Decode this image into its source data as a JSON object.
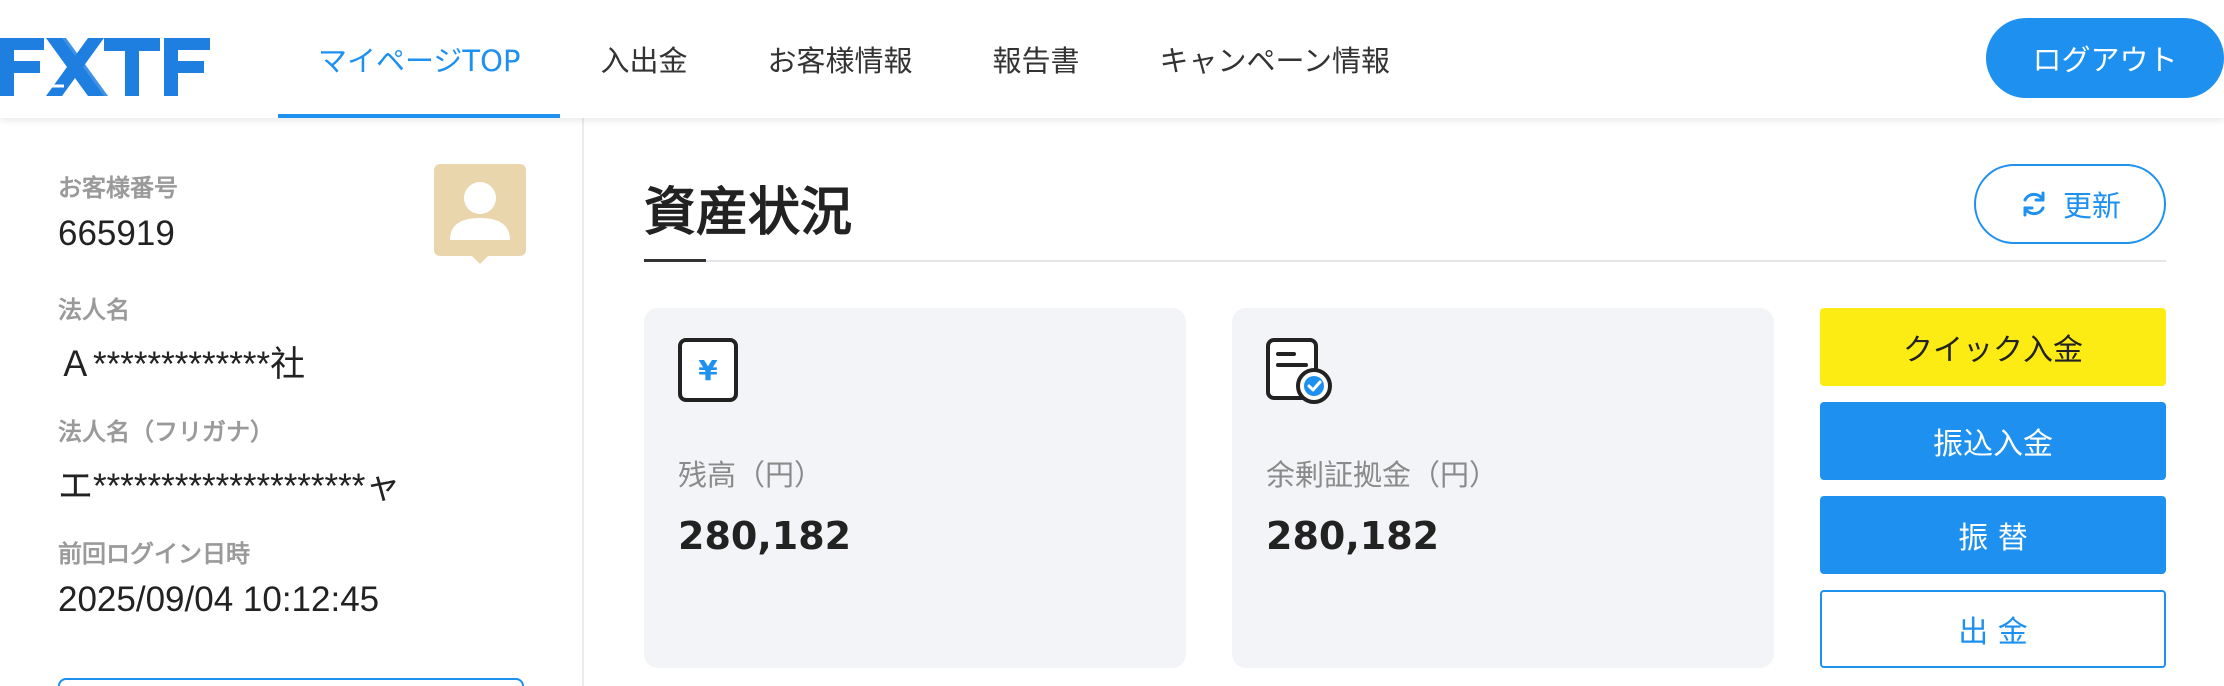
{
  "header": {
    "logo_text": "FXTF",
    "nav": [
      {
        "label": "マイページTOP"
      },
      {
        "label": "入出金"
      },
      {
        "label": "お客様情報"
      },
      {
        "label": "報告書"
      },
      {
        "label": "キャンペーン情報"
      }
    ],
    "logout_label": "ログアウト"
  },
  "sidebar": {
    "customer_number_label": "お客様番号",
    "customer_number": "665919",
    "company_name_label": "法人名",
    "company_name": "Ａ*************社",
    "company_kana_label": "法人名（フリガナ）",
    "company_kana": "エ********************ャ",
    "last_login_label": "前回ログイン日時",
    "last_login": "2025/09/04 10:12:45"
  },
  "main": {
    "title": "資産状況",
    "refresh_label": "更新",
    "cards": [
      {
        "label": "残高（円）",
        "value": "280,182",
        "icon": "yen-icon"
      },
      {
        "label": "余剰証拠金（円）",
        "value": "280,182",
        "icon": "document-check-icon"
      }
    ],
    "actions": {
      "quick_deposit": "クイック入金",
      "transfer_deposit": "振込入金",
      "transfer": "振 替",
      "withdraw": "出 金"
    }
  },
  "colors": {
    "accent": "#1e90f0",
    "quick_deposit": "#fdeb14",
    "card_bg": "#f3f4f7",
    "avatar": "#ead6ac"
  }
}
